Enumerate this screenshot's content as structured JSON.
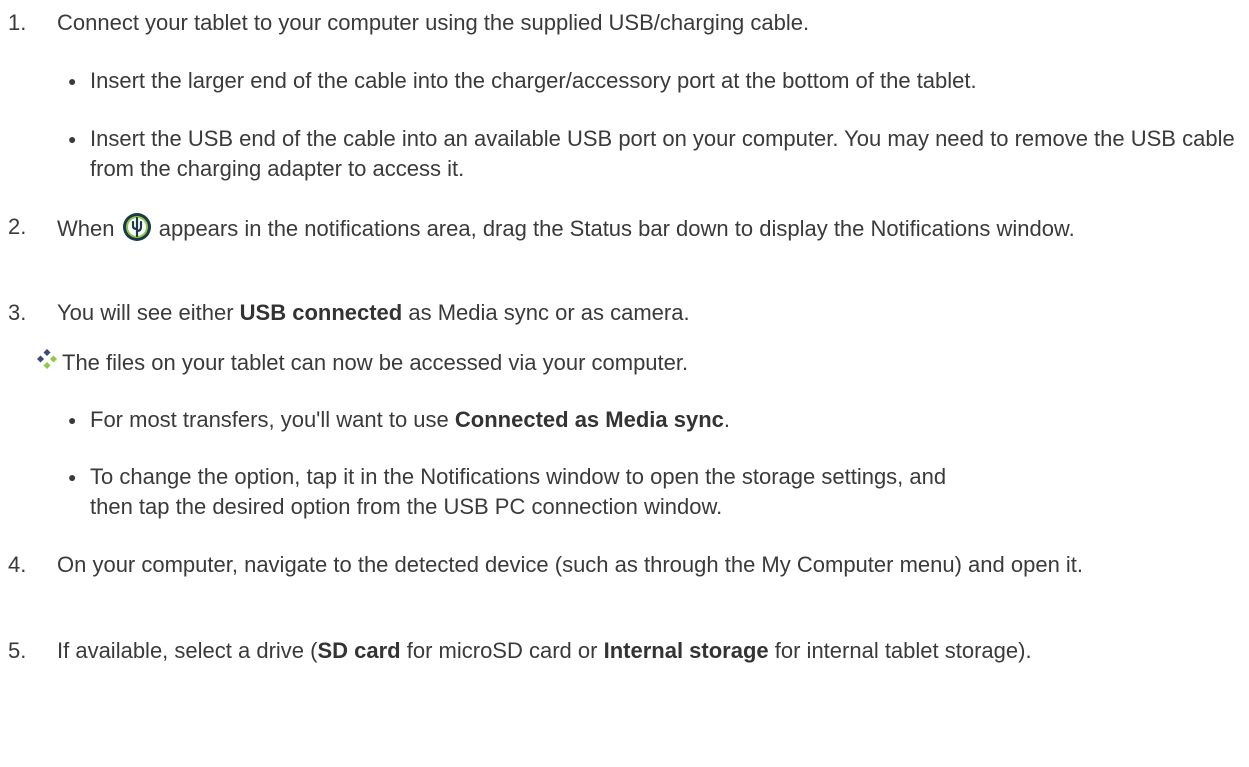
{
  "steps": {
    "s1": {
      "num": "1.",
      "text": "Connect your tablet to your computer using the supplied USB/charging cable.",
      "bullets": [
        "Insert the larger end of the cable into the charger/accessory port at the bottom of the tablet.",
        "Insert the USB end of the cable into an available USB port on your computer. You may need to remove the USB cable from the charging adapter to access it."
      ]
    },
    "s2": {
      "num": "2.",
      "pre": "When",
      "post": "appears in the notifications area, drag the Status bar down to display the Notifications window.",
      "icon": "usb-connection-icon"
    },
    "s3": {
      "num": "3.",
      "pre": "You will see either",
      "bold": "USB connected",
      "post": "as Media sync or as camera."
    },
    "result": {
      "icon": "result-diamond-icon",
      "text": "The files on your tablet can now be accessed via your computer."
    },
    "result_bullets": {
      "b1_pre": "For most transfers, you'll want to use",
      "b1_bold": "Connected as Media sync",
      "b1_post": ".",
      "b2": "To change the option, tap it in the Notifications window to open the storage settings, and then tap the desired option from the USB PC connection window."
    },
    "s4": {
      "num": "4.",
      "text": "On your computer, navigate to the detected device (such as through the My Computer menu) and open it."
    },
    "s5": {
      "num": "5.",
      "pre": "If available, select a drive (",
      "bold1": "SD card",
      "mid": "for microSD card or",
      "bold2": "Internal storage",
      "post": "for internal tablet storage)."
    }
  },
  "colors": {
    "text": "#3a3a3a",
    "icon_dark": "#1a3a4a",
    "icon_green": "#8fc84a"
  }
}
